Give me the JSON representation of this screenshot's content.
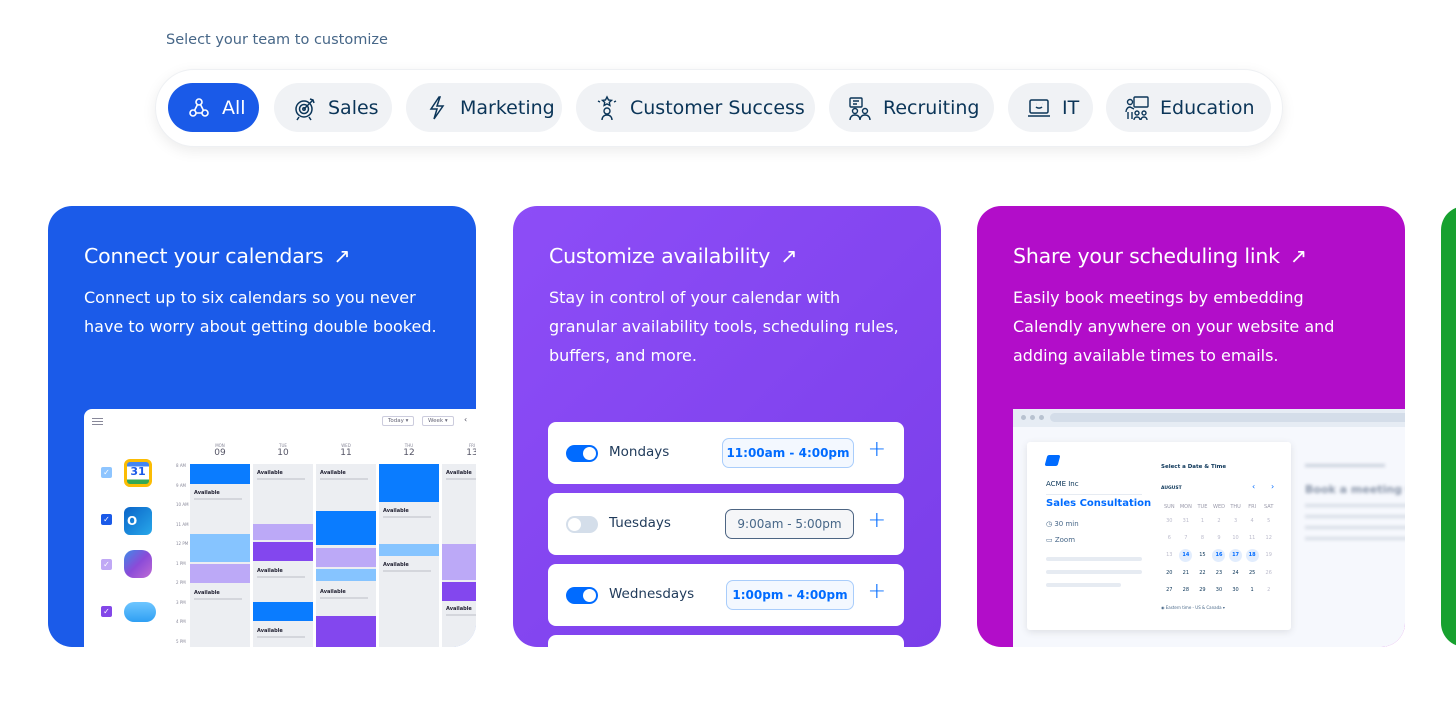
{
  "header": {
    "label": "Select your team to customize"
  },
  "tabs": [
    {
      "label": "All",
      "icon": "network-icon",
      "active": true
    },
    {
      "label": "Sales",
      "icon": "target-icon"
    },
    {
      "label": "Marketing",
      "icon": "lightning-icon"
    },
    {
      "label": "Customer Success",
      "icon": "star-person-icon"
    },
    {
      "label": "Recruiting",
      "icon": "people-icon"
    },
    {
      "label": "IT",
      "icon": "laptop-icon"
    },
    {
      "label": "Education",
      "icon": "teacher-icon"
    }
  ],
  "colors": {
    "accent": "#1a5ae8",
    "card1": "#1b5be9",
    "card2": "#8547f2",
    "card3": "#b20dc9",
    "card4": "#17a12f"
  },
  "cards": [
    {
      "title": "Connect your calendars",
      "body": "Connect up to six calendars so you never have to worry about getting double booked."
    },
    {
      "title": "Customize availability",
      "body": "Stay in control of your calendar with granular availability tools, scheduling rules, buffers, and more."
    },
    {
      "title": "Share your scheduling link",
      "body": "Easily book meetings by embedding Calendly anywhere on your website and adding available times to emails."
    }
  ],
  "calendar": {
    "today": "Today ▾",
    "week": "Week ▾",
    "days": [
      {
        "w": "MON",
        "d": "09"
      },
      {
        "w": "TUE",
        "d": "10"
      },
      {
        "w": "WED",
        "d": "11"
      },
      {
        "w": "THU",
        "d": "12"
      },
      {
        "w": "FRI",
        "d": "13"
      }
    ],
    "times": [
      "8 AM",
      "9 AM",
      "10 AM",
      "11 AM",
      "12 PM",
      "1 PM",
      "2 PM",
      "3 PM",
      "4 PM",
      "5 PM"
    ],
    "available": "Available",
    "google_day": "31"
  },
  "availability": [
    {
      "day": "Mondays",
      "time": "11:00am - 4:00pm",
      "on": true
    },
    {
      "day": "Tuesdays",
      "time": "9:00am - 5:00pm",
      "on": false
    },
    {
      "day": "Wednesdays",
      "time": "1:00pm - 4:00pm",
      "on": true
    }
  ],
  "booking": {
    "company": "ACME Inc",
    "event": "Sales Consultation",
    "duration": "30 min",
    "location": "Zoom",
    "heading": "Select a Date & Time",
    "month": "AUGUST",
    "weekdays": [
      "SUN",
      "MON",
      "TUE",
      "WED",
      "THU",
      "FRI",
      "SAT"
    ],
    "dates": [
      "30",
      "31",
      "1",
      "2",
      "3",
      "4",
      "5",
      "6",
      "7",
      "8",
      "9",
      "10",
      "11",
      "12",
      "13",
      "14",
      "15",
      "16",
      "17",
      "18",
      "19",
      "20",
      "21",
      "22",
      "23",
      "24",
      "25",
      "26",
      "27",
      "28",
      "29",
      "30",
      "30",
      "1",
      "2"
    ],
    "timezone": "Eastern time - US & Canada ▾",
    "blurred_title": "Book a meeting w"
  }
}
